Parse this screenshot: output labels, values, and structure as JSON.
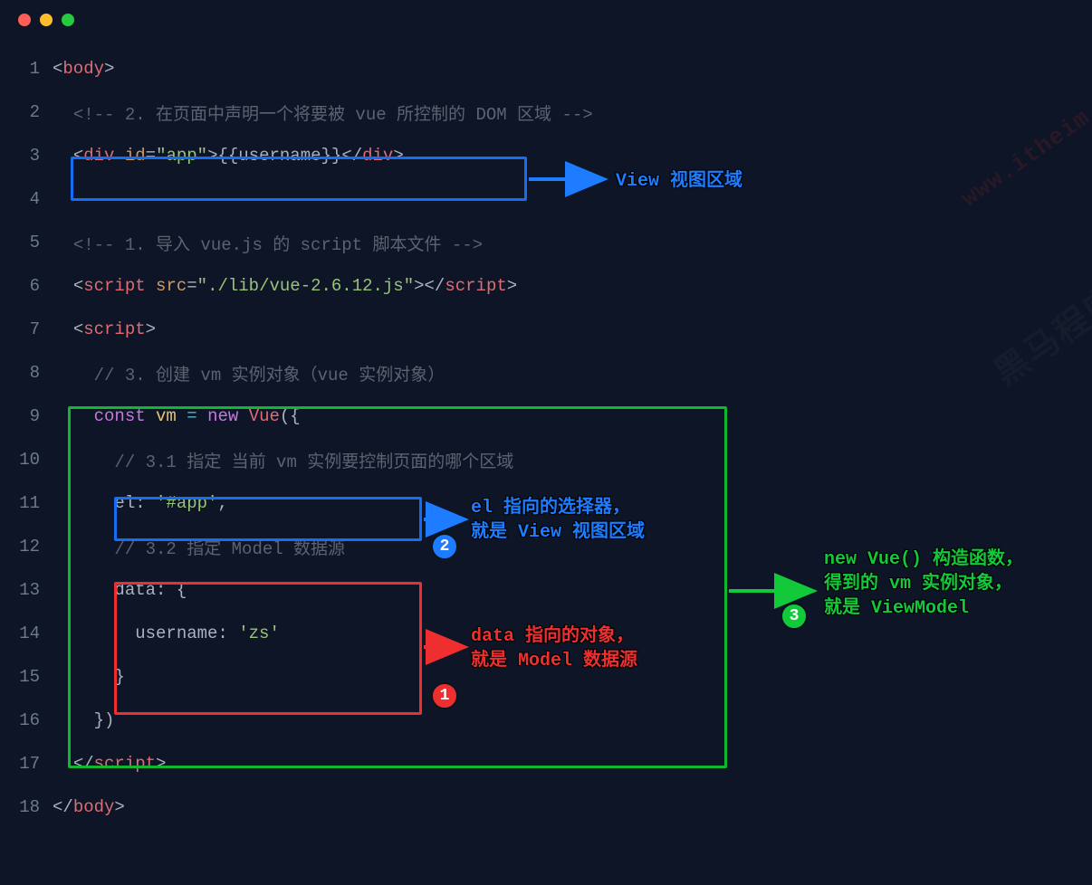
{
  "window": {
    "buttons": [
      "close",
      "minimize",
      "zoom"
    ]
  },
  "watermark": {
    "text": "黑马程序",
    "url": "www.itheim"
  },
  "code": {
    "lines": [
      {
        "n": 1,
        "seg": [
          {
            "cls": "c-punc",
            "t": "<"
          },
          {
            "cls": "c-tag",
            "t": "body"
          },
          {
            "cls": "c-punc",
            "t": ">"
          }
        ]
      },
      {
        "n": 2,
        "indent": 1,
        "seg": [
          {
            "cls": "c-comment",
            "t": "<!-- 2. 在页面中声明一个将要被 vue 所控制的 DOM 区域 -->"
          }
        ]
      },
      {
        "n": 3,
        "indent": 1,
        "seg": [
          {
            "cls": "c-punc",
            "t": "<"
          },
          {
            "cls": "c-tag",
            "t": "div"
          },
          {
            "cls": "c-plain",
            "t": " "
          },
          {
            "cls": "c-attr",
            "t": "id"
          },
          {
            "cls": "c-punc",
            "t": "="
          },
          {
            "cls": "c-string",
            "t": "\"app\""
          },
          {
            "cls": "c-punc",
            "t": ">"
          },
          {
            "cls": "c-plain",
            "t": "{{username}}"
          },
          {
            "cls": "c-punc",
            "t": "</"
          },
          {
            "cls": "c-tag",
            "t": "div"
          },
          {
            "cls": "c-punc",
            "t": ">"
          }
        ]
      },
      {
        "n": 4,
        "seg": []
      },
      {
        "n": 5,
        "indent": 1,
        "seg": [
          {
            "cls": "c-comment",
            "t": "<!-- 1. 导入 vue.js 的 script 脚本文件 -->"
          }
        ]
      },
      {
        "n": 6,
        "indent": 1,
        "seg": [
          {
            "cls": "c-punc",
            "t": "<"
          },
          {
            "cls": "c-tag",
            "t": "script"
          },
          {
            "cls": "c-plain",
            "t": " "
          },
          {
            "cls": "c-attr",
            "t": "src"
          },
          {
            "cls": "c-punc",
            "t": "="
          },
          {
            "cls": "c-string",
            "t": "\"./lib/vue-2.6.12.js\""
          },
          {
            "cls": "c-punc",
            "t": "></"
          },
          {
            "cls": "c-tag",
            "t": "script"
          },
          {
            "cls": "c-punc",
            "t": ">"
          }
        ]
      },
      {
        "n": 7,
        "indent": 1,
        "seg": [
          {
            "cls": "c-punc",
            "t": "<"
          },
          {
            "cls": "c-tag",
            "t": "script"
          },
          {
            "cls": "c-punc",
            "t": ">"
          }
        ]
      },
      {
        "n": 8,
        "indent": 2,
        "seg": [
          {
            "cls": "c-comment",
            "t": "// 3. 创建 vm 实例对象（vue 实例对象）"
          }
        ]
      },
      {
        "n": 9,
        "indent": 2,
        "seg": [
          {
            "cls": "c-keyword",
            "t": "const"
          },
          {
            "cls": "c-plain",
            "t": " "
          },
          {
            "cls": "c-var",
            "t": "vm"
          },
          {
            "cls": "c-plain",
            "t": " "
          },
          {
            "cls": "c-op",
            "t": "="
          },
          {
            "cls": "c-plain",
            "t": " "
          },
          {
            "cls": "c-keyword",
            "t": "new"
          },
          {
            "cls": "c-plain",
            "t": " "
          },
          {
            "cls": "c-id",
            "t": "Vue"
          },
          {
            "cls": "c-punc",
            "t": "({"
          }
        ]
      },
      {
        "n": 10,
        "indent": 3,
        "seg": [
          {
            "cls": "c-comment",
            "t": "// 3.1 指定 当前 vm 实例要控制页面的哪个区域"
          }
        ]
      },
      {
        "n": 11,
        "indent": 3,
        "seg": [
          {
            "cls": "c-plain",
            "t": "el: "
          },
          {
            "cls": "c-string",
            "t": "'#app'"
          },
          {
            "cls": "c-punc",
            "t": ","
          }
        ]
      },
      {
        "n": 12,
        "indent": 3,
        "seg": [
          {
            "cls": "c-comment",
            "t": "// 3.2 指定 Model 数据源"
          }
        ]
      },
      {
        "n": 13,
        "indent": 3,
        "seg": [
          {
            "cls": "c-plain",
            "t": "data: {"
          }
        ]
      },
      {
        "n": 14,
        "indent": 4,
        "seg": [
          {
            "cls": "c-plain",
            "t": "username: "
          },
          {
            "cls": "c-string",
            "t": "'zs'"
          }
        ]
      },
      {
        "n": 15,
        "indent": 3,
        "seg": [
          {
            "cls": "c-plain",
            "t": "}"
          }
        ]
      },
      {
        "n": 16,
        "indent": 2,
        "seg": [
          {
            "cls": "c-punc",
            "t": "})"
          }
        ]
      },
      {
        "n": 17,
        "indent": 1,
        "seg": [
          {
            "cls": "c-punc",
            "t": "</"
          },
          {
            "cls": "c-tag",
            "t": "script"
          },
          {
            "cls": "c-punc",
            "t": ">"
          }
        ]
      },
      {
        "n": 18,
        "seg": [
          {
            "cls": "c-punc",
            "t": "</"
          },
          {
            "cls": "c-tag",
            "t": "body"
          },
          {
            "cls": "c-punc",
            "t": ">"
          }
        ]
      }
    ]
  },
  "annotations": {
    "view": "View 视图区域",
    "el": "el 指向的选择器，\n就是 View 视图区域",
    "data": "data 指向的对象，\n就是 Model 数据源",
    "vm": "new Vue() 构造函数，\n得到的 vm 实例对象，\n就是 ViewModel"
  },
  "badges": {
    "b1": "1",
    "b2": "2",
    "b3": "3"
  }
}
